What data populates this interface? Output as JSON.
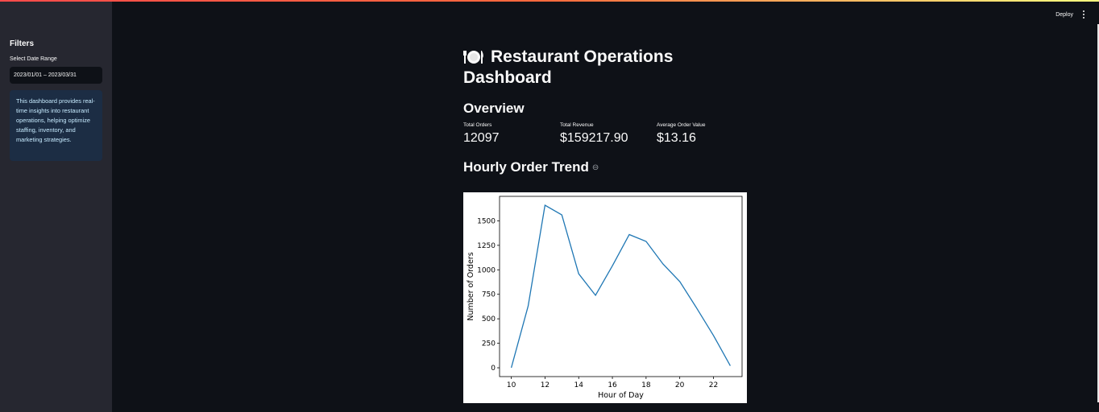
{
  "header": {
    "deploy_label": "Deploy"
  },
  "sidebar": {
    "title": "Filters",
    "date_label": "Select Date Range",
    "date_value": "2023/01/01 – 2023/03/31",
    "info_text": "This dashboard provides real-time insights into restaurant operations, helping optimize staffing, inventory, and marketing strategies."
  },
  "main": {
    "title_line1": "Restaurant Operations",
    "title_line2": "Dashboard",
    "overview_heading": "Overview",
    "metrics": [
      {
        "label": "Total Orders",
        "value": "12097"
      },
      {
        "label": "Total Revenue",
        "value": "$159217.90"
      },
      {
        "label": "Average Order Value",
        "value": "$13.16"
      }
    ],
    "trend_heading": "Hourly Order Trend"
  },
  "chart_data": {
    "type": "line",
    "title": "",
    "xlabel": "Hour of Day",
    "ylabel": "Number of Orders",
    "x": [
      10,
      11,
      12,
      13,
      14,
      15,
      16,
      17,
      18,
      19,
      20,
      21,
      22,
      23
    ],
    "values": [
      0,
      630,
      1660,
      1560,
      960,
      740,
      1040,
      1360,
      1290,
      1060,
      880,
      610,
      330,
      20
    ],
    "xticks": [
      10,
      12,
      14,
      16,
      18,
      20,
      22
    ],
    "yticks": [
      0,
      250,
      500,
      750,
      1000,
      1250,
      1500
    ],
    "xlim": [
      9.3,
      23.7
    ],
    "ylim": [
      -90,
      1750
    ],
    "line_color": "#1f77b4",
    "grid": false,
    "legend": false
  }
}
